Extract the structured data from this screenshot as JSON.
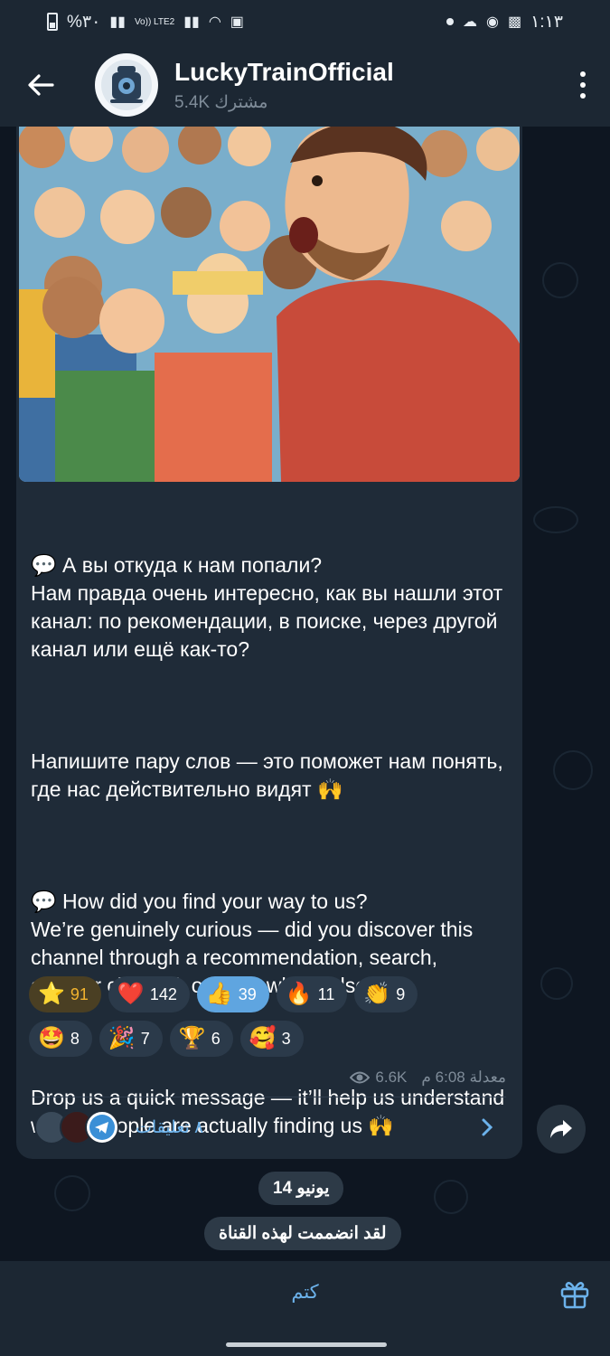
{
  "status": {
    "battery_text": "%٣٠",
    "network": "Vo)) LTE2",
    "time": "١:١٣"
  },
  "header": {
    "title": "LuckyTrainOfficial",
    "subscribers": "5.4K مشترك"
  },
  "post": {
    "text_ru_1": "💬 А вы откуда к нам попали?\nНам правда очень интересно, как вы нашли этот канал: по рекомендации, в поиске, через другой канал или ещё как-то?",
    "text_ru_2": "Напишите пару слов — это поможет нам понять, где нас действительно видят 🙌",
    "text_en_1": "💬 How did you find your way to us?\nWe’re genuinely curious — did you discover this channel through a recommendation, search, another channel, or somewhere else?",
    "text_en_2": "Drop us a quick message — it’ll help us understand where people are actually finding us 🙌",
    "reactions": [
      {
        "emoji": "⭐",
        "count": "91",
        "style": "gold"
      },
      {
        "emoji": "❤️",
        "count": "142",
        "style": "normal"
      },
      {
        "emoji": "👍",
        "count": "39",
        "style": "active"
      },
      {
        "emoji": "🔥",
        "count": "11",
        "style": "normal"
      },
      {
        "emoji": "👏",
        "count": "9",
        "style": "normal"
      },
      {
        "emoji": "🤩",
        "count": "8",
        "style": "normal"
      },
      {
        "emoji": "🎉",
        "count": "7",
        "style": "normal"
      },
      {
        "emoji": "🏆",
        "count": "6",
        "style": "normal"
      },
      {
        "emoji": "🥰",
        "count": "3",
        "style": "normal"
      }
    ],
    "views": "6.6K",
    "time": "معدلة 6:08 م",
    "comments_label": "٨ تعليقات"
  },
  "date_pill": "14 يونيو",
  "service_message": "لقد انضممت لهذه القناة",
  "bottom": {
    "mute_label": "كتم"
  },
  "colors": {
    "accent": "#6cb2eb",
    "bubble": "#1f2b38",
    "background": "#0e1621"
  }
}
